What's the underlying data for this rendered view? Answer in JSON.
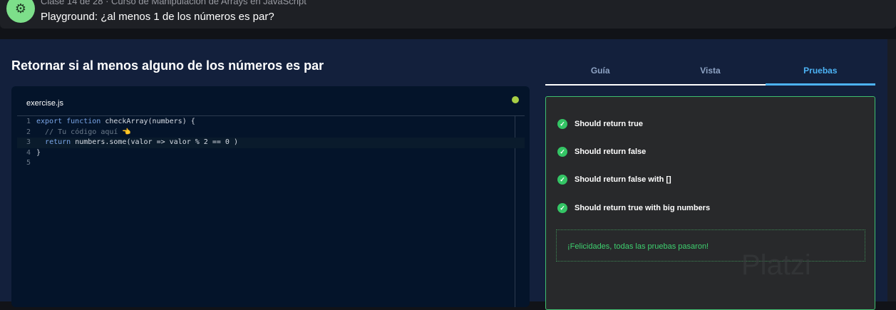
{
  "header": {
    "subtitle": "Clase 14 de 28 · Curso de Manipulación de Arrays en JavaScript",
    "title": "Playground: ¿al menos 1 de los números es par?"
  },
  "main": {
    "title": "Retornar si al menos alguno de los números es par"
  },
  "editor": {
    "filename": "exercise.js",
    "lines": [
      {
        "n": "1"
      },
      {
        "n": "2"
      },
      {
        "n": "3"
      },
      {
        "n": "4"
      },
      {
        "n": "5"
      }
    ]
  },
  "tabs": [
    "Guía",
    "Vista",
    "Pruebas"
  ],
  "tests": [
    "Should return true",
    "Should return false",
    "Should return false with []",
    "Should return true with big numbers"
  ],
  "congrats": "¡Felicidades, todas las pruebas pasaron!",
  "watermark": "Platzi",
  "colors": {
    "accent": "#4cb3f5",
    "success": "#34c565"
  }
}
